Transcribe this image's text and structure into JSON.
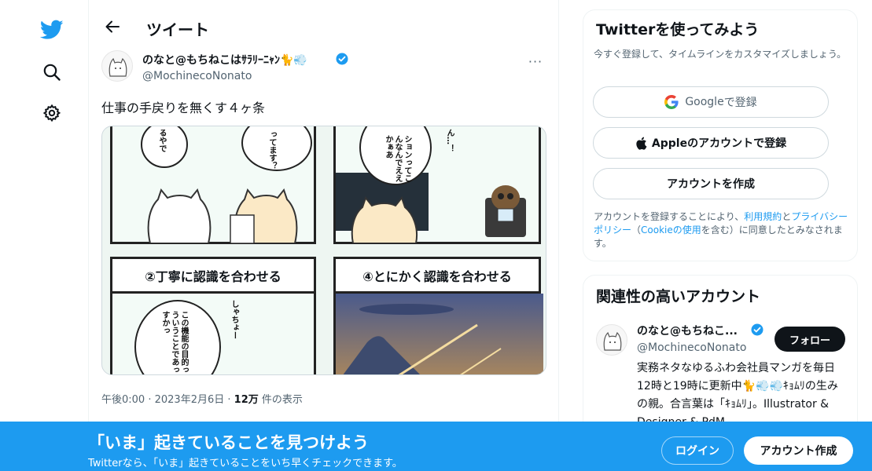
{
  "colors": {
    "brand": "#1d9bf0",
    "text": "#0f1419",
    "muted": "#536471",
    "follow_bg": "#0f1419"
  },
  "nav": {
    "icons": [
      "twitter-logo-icon",
      "search-icon",
      "gear-icon"
    ]
  },
  "header": {
    "title": "ツイート"
  },
  "tweet": {
    "author_name": "のなと@もちねこはｻﾗﾘｰﾆｬﾝ🐈💨",
    "author_handle": "@MochinecoNonato",
    "more_label": "···",
    "text": "仕事の手戻りを無くす４ヶ条",
    "media": {
      "panel3_title": "②丁寧に認識を合わせる",
      "panel4_title": "④とにかく認識を合わせる",
      "speech": {
        "p1": "るやで",
        "p2": "ってます？",
        "p3": "ションってこんなんでええかぁあ",
        "p4": "ん…！",
        "p5": "この機能の目的ってこういうことであってますかっ",
        "p6": "しゃちょー"
      }
    },
    "meta": {
      "time": "午後0:00",
      "sep": " · ",
      "date": "2023年2月6日",
      "views_count": "12万",
      "views_label": " 件の表示"
    }
  },
  "signup_card": {
    "title": "Twitterを使ってみよう",
    "subtitle": "今すぐ登録して、タイムラインをカスタマイズしましょう。",
    "google_brand": "Google",
    "google_suffix": " で登録",
    "apple_label": "Appleのアカウントで登録",
    "create_label": "アカウントを作成",
    "legal": {
      "p1": "アカウントを登録することにより、",
      "terms": "利用規約",
      "p2": "と",
      "privacy": "プライバシーポリシー",
      "p3": "（",
      "cookie": "Cookieの使用",
      "p4": "を含む）に同意したとみなされます。"
    }
  },
  "related": {
    "title": "関連性の高いアカウント",
    "name": "のなと@もちねこ...",
    "handle": "@MochinecoNonato",
    "follow_label": "フォロー",
    "bio": "実務ネタなゆるふわ会社員マンガを毎日12時と19時に更新中🐈💨💨ｷｮﾑﾘの生みの親。合言葉は「ｷｮﾑﾘ」。Illustrator & Designer & PdM。"
  },
  "bottom": {
    "title": "「いま」起きていることを見つけよう",
    "subtitle": "Twitterなら、「いま」起きていることをいち早くチェックできます。",
    "login_label": "ログイン",
    "signup_label": "アカウント作成"
  }
}
